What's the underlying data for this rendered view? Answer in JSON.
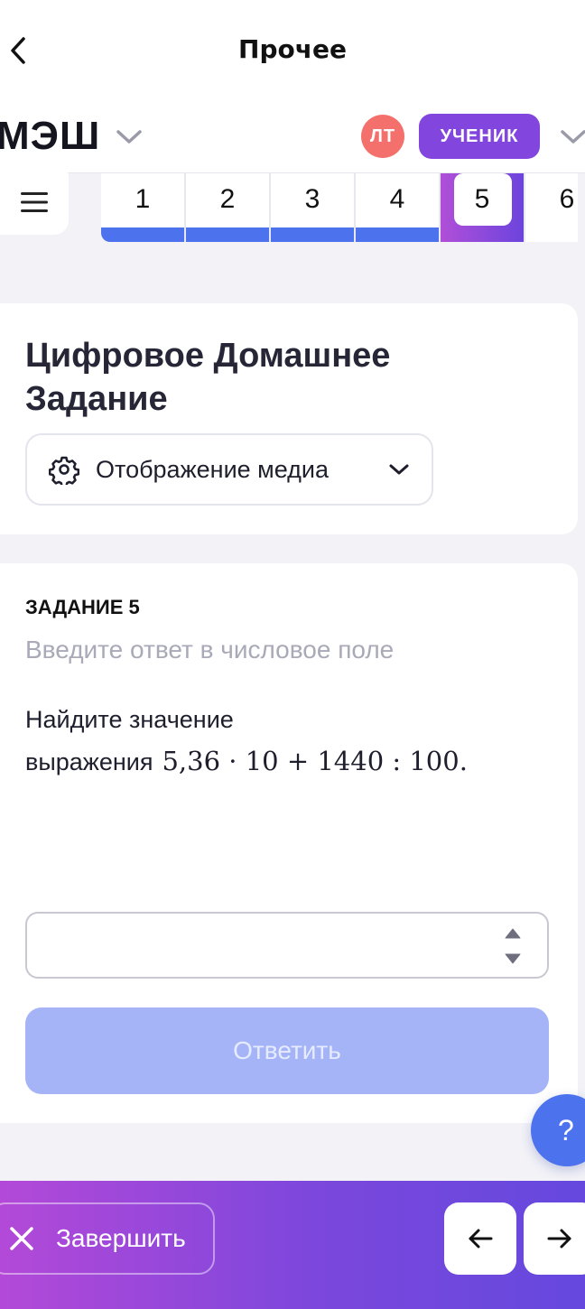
{
  "header": {
    "title": "Прочее",
    "back_icon": "chevron-left-icon"
  },
  "brand": {
    "logo_text": "МЭШ",
    "avatar_initials": "ЛТ",
    "role_label": "УЧЕНИК",
    "colors": {
      "avatar": "#f3706c",
      "role_badge": "#8245dd"
    }
  },
  "steps": {
    "items": [
      "1",
      "2",
      "3",
      "4",
      "5",
      "6"
    ],
    "completed": [
      "1",
      "2",
      "3",
      "4"
    ],
    "current": "5",
    "colors": {
      "done_bar": "#4d72ee",
      "active_gradient": [
        "#b04fd8",
        "#6c44dd"
      ]
    }
  },
  "homework": {
    "title": "Цифровое Домашнее Задание",
    "media_select_label": "Отображение медиа"
  },
  "task": {
    "label": "ЗАДАНИЕ 5",
    "hint": "Введите ответ в числовое поле",
    "text_line1": "Найдите значение",
    "text_line2": "выражения",
    "expression": "5,36 · 10 + 1440 : 100.",
    "answer_value": "",
    "submit_label": "Ответить"
  },
  "help": {
    "label": "?"
  },
  "footer": {
    "finish_label": "Завершить",
    "prev_icon": "arrow-left-icon",
    "next_icon": "arrow-right-icon",
    "gradient": [
      "#b349d8",
      "#6548de"
    ]
  }
}
